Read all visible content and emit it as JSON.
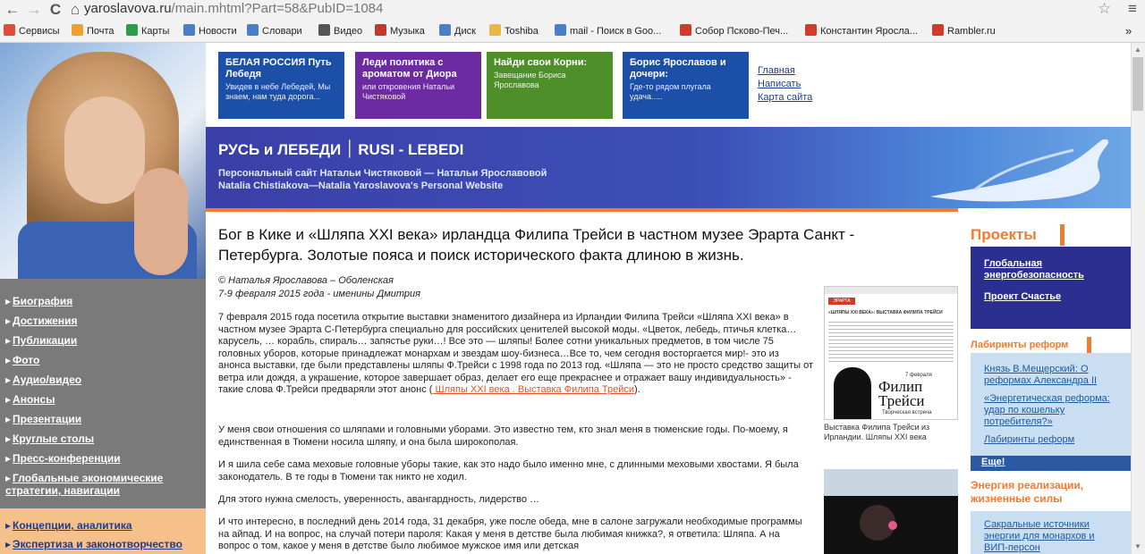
{
  "browser": {
    "address_domain": "yaroslavova.ru",
    "address_path": "/main.mhtml?Part=58&PubID=1084",
    "back": "←",
    "forward": "→",
    "reload": "C",
    "home": "⌂",
    "star": "☆",
    "menu": "≡",
    "bookmarks": [
      {
        "label": "Сервисы",
        "color": "#e04b3a"
      },
      {
        "label": "Почта",
        "color": "#f0a030"
      },
      {
        "label": "Карты",
        "color": "#2e9d4a"
      },
      {
        "label": "Новости",
        "color": "#4a7ec9"
      },
      {
        "label": "Словари",
        "color": "#4a7ec9"
      },
      {
        "label": "Видео",
        "color": "#555555"
      },
      {
        "label": "Музыка",
        "color": "#c0392b"
      },
      {
        "label": "Диск",
        "color": "#4a7ec9"
      },
      {
        "label": "Toshiba",
        "color": "#e8b847"
      },
      {
        "label": "mail - Поиск в Goo...",
        "color": "#4a7ec9"
      },
      {
        "label": "Собор Псково-Печ...",
        "color": "#d23a2a"
      },
      {
        "label": "Константин Яросла...",
        "color": "#d23a2a"
      },
      {
        "label": "Rambler.ru",
        "color": "#d23a2a"
      }
    ],
    "more": "»"
  },
  "tiles": [
    {
      "title": "БЕЛАЯ РОССИЯ Путь Лебедя",
      "desc": "Увидев в небе Лебедей, Мы знаем, нам туда дорога...",
      "color": "#1c4fa8"
    },
    {
      "title": "Леди политика с ароматом от Диора",
      "desc": "или откровения Натальи Чистяковой",
      "color": "#6d2ba2"
    },
    {
      "title": "Найди свои Корни:",
      "desc": "Завещание Бориса Ярославова",
      "color": "#4f8f2a"
    },
    {
      "title": "Борис Ярославов и дочери:",
      "desc": "Где-то рядом плугала удача.....",
      "color": "#1c4fa8"
    }
  ],
  "top_links": [
    "Главная",
    "Написать",
    "Карта сайта"
  ],
  "banner": {
    "title": "РУСЬ и ЛЕБЕДИ ׀ RUSI - LEBEDI",
    "sub1": "Персональный сайт Натальи Чистяковой — Натальи Ярославовой",
    "sub2": "Natalia Chistiakova—Natalia Yaroslavova's Personal Website"
  },
  "left_nav": [
    "Биография",
    "Достижения",
    "Публикации",
    "Фото",
    "Аудио/видео",
    "Анонсы",
    "Презентации",
    "Круглые столы",
    "Пресс-конференции",
    "Глобальные экономические стратегии, навигации"
  ],
  "left_nav_2": [
    "Концепции, аналитика",
    "Экспертиза и законотворчество"
  ],
  "article": {
    "title": "Бог в Кике и «Шляпа XXI века» ирландца Филипа Трейси в частном музее Эрарта Санкт - Петербурга. Золотые пояса и поиск исторического факта длиною в жизнь.",
    "author": "© Наталья Ярославова – Оболенская",
    "date": "7-9 февраля 2015 года - именины Дмитрия",
    "p1_text": "7 февраля 2015 года посетила открытие выставки знаменитого дизайнера из Ирландии Филипа Трейси «Шляпа XXI века» в частном музее Эрарта С-Петербурга специально для российских ценителей высокой моды. «Цветок, лебедь, птичья клетка… карусель, … корабль, спираль… запястье руки…! Все это — шляпы! Более сотни уникальных предметов, в том числе 75 головных уборов, которые принадлежат монархам и звездам шоу-бизнеса…Все то, чем сегодня восторгается мир!- это из анонса выставки, где были представлены шляпы Ф.Трейси с 1998 года по 2013 год. «Шляпа — это не просто средство защиты от ветра или дождя, а украшение, которое завершает образ, делает его еще прекраснее и отражает вашу индивидуальность» - такие слова Ф.Трейси предваряли этот анонс (",
    "p1_link": " Шляпы XXI века . Выставка Филипа Трейси",
    "p1_end": ").",
    "p2": "У меня свои отношения со шляпами и головными уборами. Это известно тем, кто знал меня в тюменские годы. По-моему, я единственная в Тюмени носила шляпу, и она была широкополая.",
    "p3": "И я шила себе сама меховые головные уборы такие, как это надо было именно мне, с длинными меховыми хвостами. Я была законодатель. В те годы в Тюмени так никто не ходил.",
    "p4": "Для этого нужна смелость, уверенность, авангардность, лидерство …",
    "p5": "И что интересно, в последний день 2014 года, 31 декабря, уже после обеда, мне в салоне загружали необходимые программы на айпад. И на вопрос, на случай потери пароля: Какая у меня в детстве была любимая книжка?, я ответила: Шляпа. А на вопрос о том, какое у меня в детстве было любимое мужское имя или детская"
  },
  "thumb1": {
    "caption": "Выставка Филипа Трейси из Ирландии. Шляпы XXI века",
    "header": "«ШЛЯПЫ XXI ВЕКА»: ВЫСТАВКА ФИЛИПА ТРЕЙСИ",
    "logo": "ЭРАРТА",
    "poster_title": "Филип Трейси",
    "poster_date": "7 февраля",
    "poster_sub": "Творческая встреча"
  },
  "right": {
    "projects_head": "Проекты",
    "projects": [
      "Глобальная энергобезопасность",
      "Проект Счастье"
    ],
    "labs_head": "Лабиринты реформ",
    "labs": [
      "Князь В.Мещерский: О реформах Александра II",
      "«Энергетическая реформа: удар по кошельку потребителя?»",
      "Лабиринты реформ"
    ],
    "more": "Еще!",
    "energy_head": "Энергия реализации, жизненные силы",
    "energy_link": "Сакральные источники энергии для монархов и ВИП-персон"
  },
  "scroll": {
    "up": "▲",
    "down": "▼"
  }
}
